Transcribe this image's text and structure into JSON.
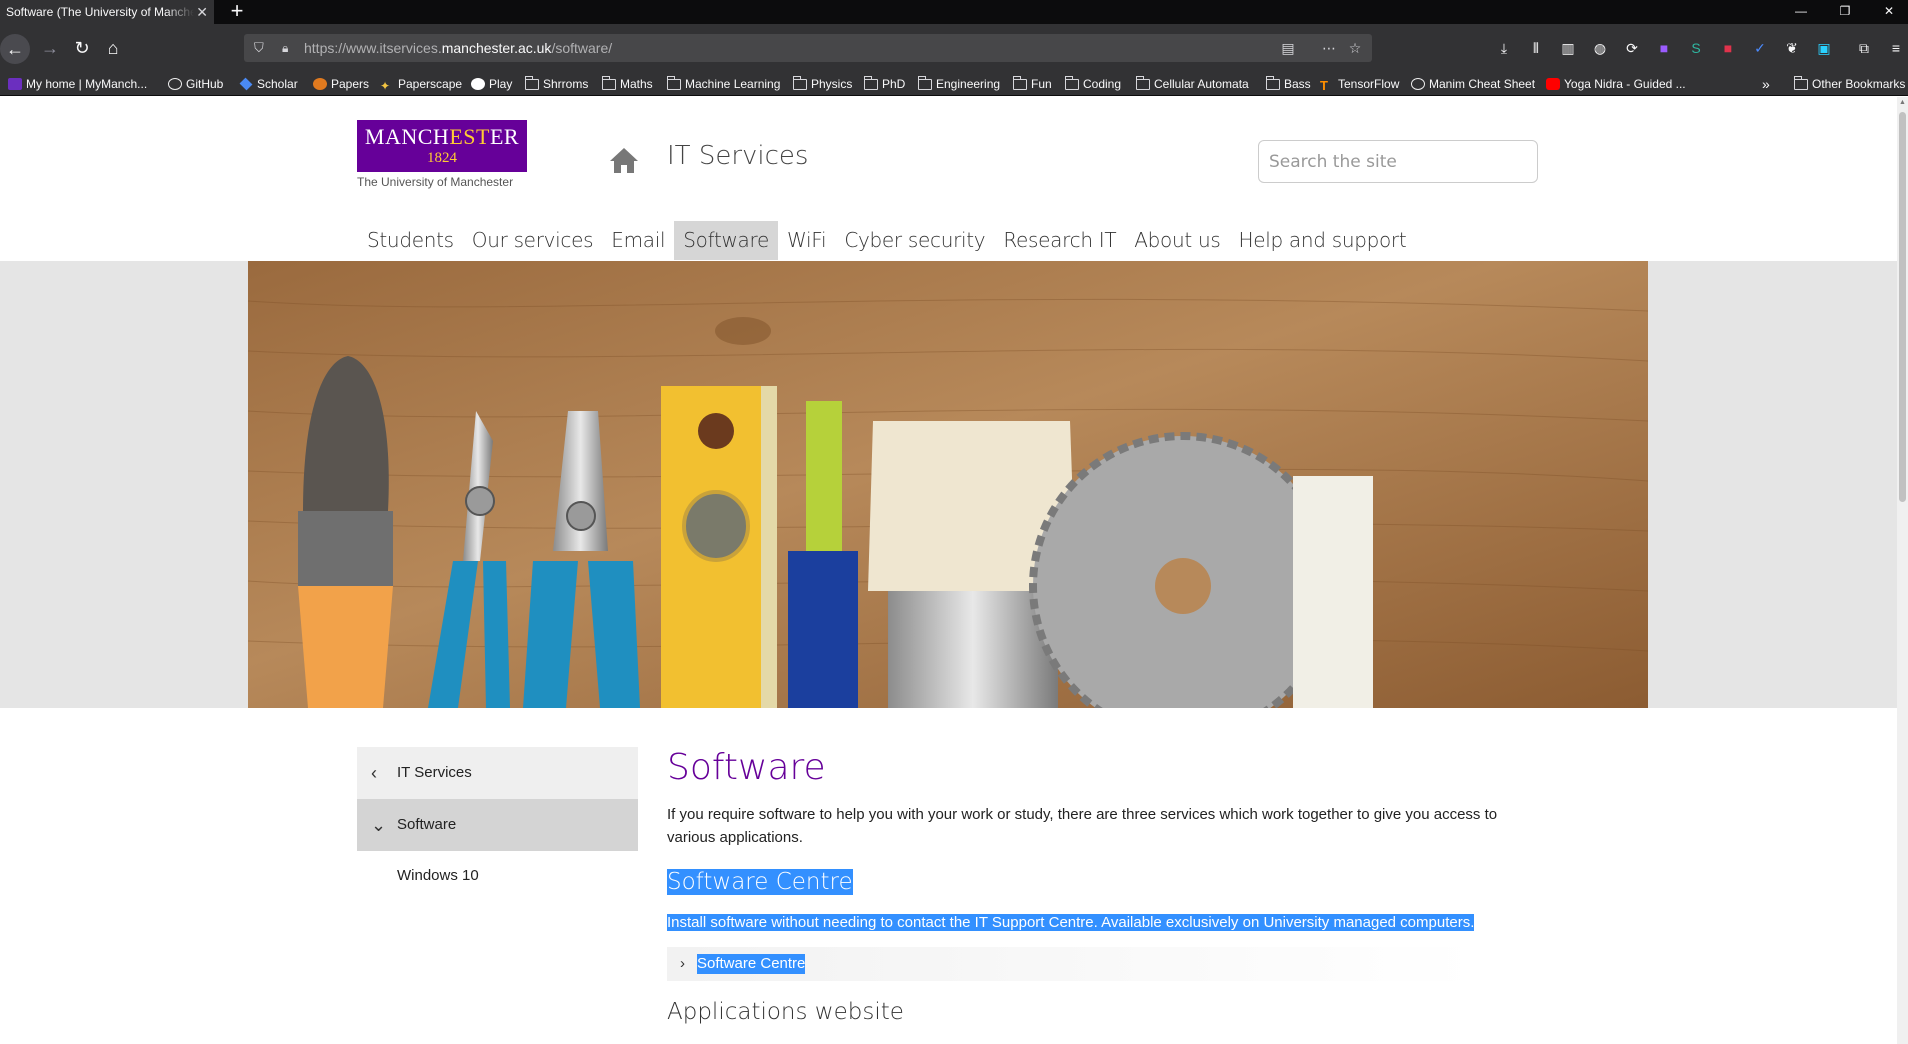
{
  "browser": {
    "tab_title": "Software (The University of Manchester)",
    "url_prefix": "https://www.itservices.",
    "url_domain": "manchester.ac.uk",
    "url_path": "/software/",
    "bookmarks": [
      {
        "label": "My home | MyManch...",
        "icon": "mymanchester-icon"
      },
      {
        "label": "GitHub",
        "icon": "github-icon"
      },
      {
        "label": "Scholar",
        "icon": "scholar-icon"
      },
      {
        "label": "Papers",
        "icon": "papers-icon"
      },
      {
        "label": "Paperscape",
        "icon": "paperscape-icon"
      },
      {
        "label": "Play",
        "icon": "play-icon"
      },
      {
        "label": "Shrroms",
        "icon": "folder-icon"
      },
      {
        "label": "Maths",
        "icon": "folder-icon"
      },
      {
        "label": "Machine Learning",
        "icon": "folder-icon"
      },
      {
        "label": "Physics",
        "icon": "folder-icon"
      },
      {
        "label": "PhD",
        "icon": "folder-icon"
      },
      {
        "label": "Engineering",
        "icon": "folder-icon"
      },
      {
        "label": "Fun",
        "icon": "folder-icon"
      },
      {
        "label": "Coding",
        "icon": "folder-icon"
      },
      {
        "label": "Cellular Automata",
        "icon": "folder-icon"
      },
      {
        "label": "Bass",
        "icon": "folder-icon"
      },
      {
        "label": "TensorFlow",
        "icon": "tensorflow-icon"
      },
      {
        "label": "Manim Cheat Sheet",
        "icon": "github-icon"
      },
      {
        "label": "Yoga Nidra - Guided ...",
        "icon": "youtube-icon"
      }
    ],
    "other_bookmarks": "Other Bookmarks",
    "colors": {
      "chrome": "#323234",
      "urlbar": "#474749",
      "selection": "#3390ff"
    }
  },
  "site": {
    "logo_line1_a": "MANCH",
    "logo_line1_b": "EST",
    "logo_line1_c": "ER",
    "logo_year": "1824",
    "logo_sub": "The University of Manchester",
    "title": "IT Services",
    "search_placeholder": "Search the site",
    "nav": [
      {
        "label": "Students",
        "active": false
      },
      {
        "label": "Our services",
        "active": false
      },
      {
        "label": "Email",
        "active": false
      },
      {
        "label": "Software",
        "active": true
      },
      {
        "label": "WiFi",
        "active": false
      },
      {
        "label": "Cyber security",
        "active": false
      },
      {
        "label": "Research IT",
        "active": false
      },
      {
        "label": "About us",
        "active": false
      },
      {
        "label": "Help and support",
        "active": false
      }
    ],
    "brand_purple": "#660099"
  },
  "sidebar": {
    "back": "IT Services",
    "current": "Software",
    "sub": "Windows 10"
  },
  "content": {
    "heading": "Software",
    "intro": "If you require software to help you with your work or study, there are three services which work together to give you access to various applications.",
    "section1_title": "Software Centre",
    "section1_text": "Install software without needing to contact the IT Support Centre. Available exclusively on University managed computers.",
    "section1_link": "Software Centre",
    "section2_title": "Applications website"
  }
}
